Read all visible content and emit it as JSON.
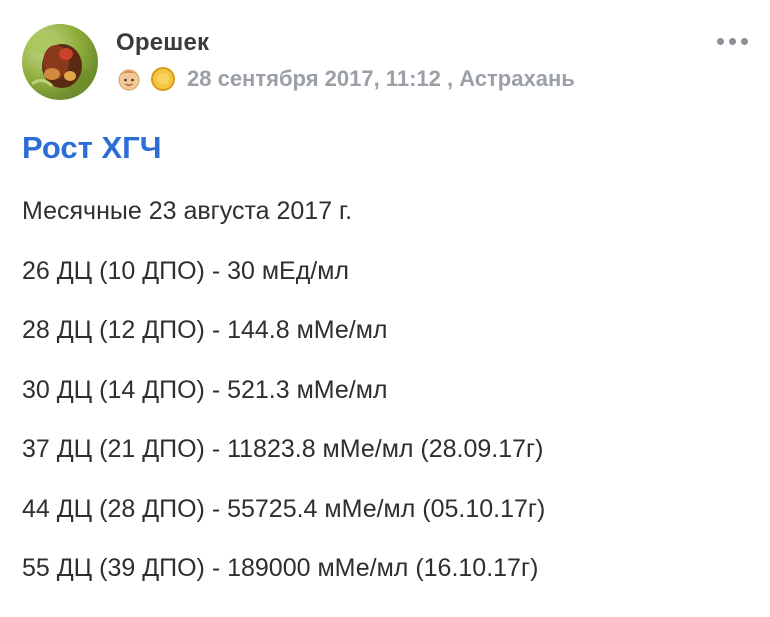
{
  "post": {
    "author": "Орешек",
    "meta": "28 сентября 2017, 11:12 , Астрахань",
    "title": "Рост ХГЧ",
    "lines": [
      "Месячные 23 августа 2017 г.",
      "26 ДЦ (10 ДПО) - 30 мЕд/мл",
      "28 ДЦ (12 ДПО) - 144.8 мМе/мл",
      "30 ДЦ (14 ДПО) - 521.3 мМе/мл",
      "37 ДЦ (21 ДПО) - 11823.8 мМе/мл (28.09.17г)",
      "44 ДЦ (28 ДПО) - 55725.4 мМе/мл (05.10.17г)",
      "55 ДЦ (39 ДПО) - 189000 мМе/мл (16.10.17г)"
    ]
  },
  "icons": {
    "avatar": "nut-photo-avatar",
    "badge_1": "face-icon",
    "badge_2": "gold-circle-icon",
    "more": "more-dots-icon"
  },
  "colors": {
    "title": "#2d6ed6",
    "meta": "#9aa0a6",
    "author": "#3b3b3b",
    "text": "#2f2f2f"
  }
}
